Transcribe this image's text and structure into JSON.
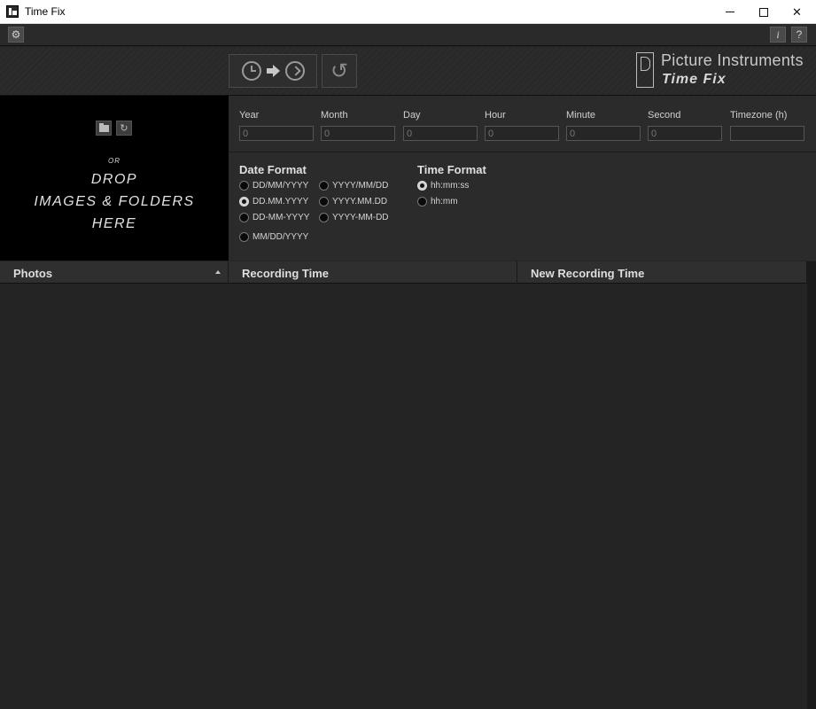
{
  "window": {
    "title": "Time Fix",
    "minimize_icon": "minimize-icon",
    "maximize_icon": "maximize-icon",
    "close_glyph": "✕"
  },
  "toolbar": {
    "settings_glyph": "⚙",
    "info_label": "i",
    "help_label": "?"
  },
  "actions": {
    "convert_icon": "clock-arrow-clock-icon",
    "undo_glyph": "↺"
  },
  "brand": {
    "company": "Picture Instruments",
    "product": "Time Fix"
  },
  "dropzone": {
    "refresh_glyph": "↻",
    "or_text": "OR",
    "line1": "DROP",
    "line2": "IMAGES & FOLDERS",
    "line3": "HERE"
  },
  "time_fields": [
    {
      "label": "Year",
      "value": "",
      "placeholder": "0"
    },
    {
      "label": "Month",
      "value": "",
      "placeholder": "0"
    },
    {
      "label": "Day",
      "value": "",
      "placeholder": "0"
    },
    {
      "label": "Hour",
      "value": "",
      "placeholder": "0"
    },
    {
      "label": "Minute",
      "value": "",
      "placeholder": "0"
    },
    {
      "label": "Second",
      "value": "",
      "placeholder": "0"
    },
    {
      "label": "Timezone (h)",
      "value": "",
      "placeholder": ""
    }
  ],
  "date_format": {
    "title": "Date Format",
    "options": [
      {
        "label": "DD/MM/YYYY",
        "selected": false
      },
      {
        "label": "YYYY/MM/DD",
        "selected": false
      },
      {
        "label": "DD.MM.YYYY",
        "selected": true
      },
      {
        "label": "YYYY.MM.DD",
        "selected": false
      },
      {
        "label": "DD-MM-YYYY",
        "selected": false
      },
      {
        "label": "YYYY-MM-DD",
        "selected": false
      },
      {
        "label": "MM/DD/YYYY",
        "selected": false
      }
    ]
  },
  "time_format": {
    "title": "Time Format",
    "options": [
      {
        "label": "hh:mm:ss",
        "selected": true
      },
      {
        "label": "hh:mm",
        "selected": false
      }
    ]
  },
  "table": {
    "columns": [
      "Photos",
      "Recording Time",
      "New Recording Time"
    ],
    "sort_column": "Photos",
    "sort_direction": "ascending",
    "rows": []
  }
}
